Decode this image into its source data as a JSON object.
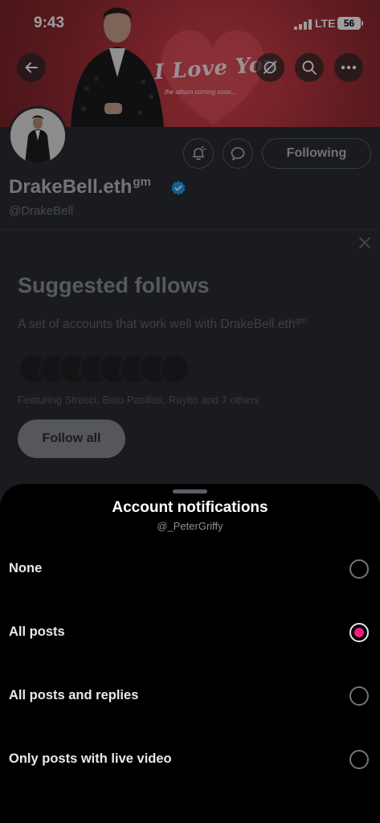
{
  "status_bar": {
    "time": "9:43",
    "network": "LTE",
    "battery": "56"
  },
  "banner": {
    "headline": "I Love You",
    "tagline": "the album coming soon..."
  },
  "profile": {
    "display_name": "DrakeBell.eth",
    "name_suffix": "gm",
    "handle": "@DrakeBell",
    "following_label": "Following",
    "verified_color": "#1d9bf0"
  },
  "suggested": {
    "title": "Suggested follows",
    "description": "A set of accounts that work well with DrakeBell.eth",
    "description_suffix": "gm",
    "featuring": "Featuring Strecci, Beto Pasillas, Rayito and 7 others",
    "follow_all_label": "Follow all",
    "avatar_count": 8
  },
  "sheet": {
    "title": "Account notifications",
    "subtitle": "@_PeterGriffy",
    "accent_color": "#f91880",
    "options": [
      {
        "label": "None",
        "selected": false
      },
      {
        "label": "All posts",
        "selected": true
      },
      {
        "label": "All posts and replies",
        "selected": false
      },
      {
        "label": "Only posts with live video",
        "selected": false
      }
    ]
  }
}
